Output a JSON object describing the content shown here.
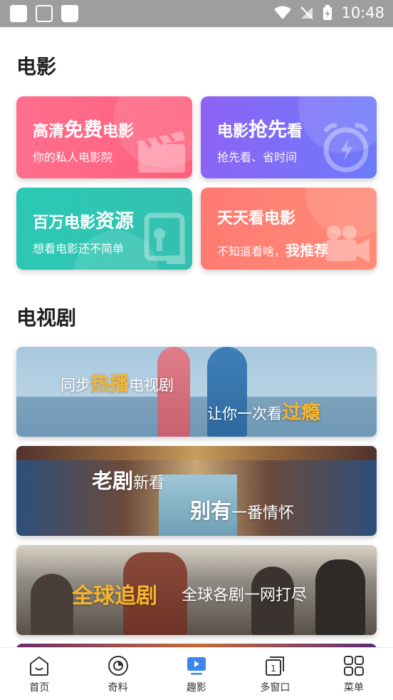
{
  "status_bar": {
    "time": "10:48"
  },
  "movies": {
    "section_title": "电影",
    "cards": [
      {
        "title_pre": "高清",
        "title_big": "免费",
        "title_post": "电影",
        "subtitle": "你的私人电影院",
        "icon": "clapperboard-icon"
      },
      {
        "title_pre": "电影",
        "title_big": "抢先",
        "title_post": "看",
        "subtitle": "抢先看、省时间",
        "icon": "alarm-clock-icon"
      },
      {
        "title_pre": "百万电影",
        "title_big": "资源",
        "title_post": "",
        "subtitle": "想看电影还不简单",
        "icon": "film-doc-icon"
      },
      {
        "title_pre": "天天看电影",
        "title_big": "",
        "title_post": "",
        "subtitle_pre": "不知道看啥，",
        "subtitle_bold": "我推荐",
        "icon": "projector-icon"
      }
    ]
  },
  "tv": {
    "section_title": "电视剧",
    "banners": [
      {
        "line1_pre": "同步",
        "line1_hl": "热播",
        "line1_post": "电视剧",
        "line2_pre": "让你一次看",
        "line2_hl": "过瘾"
      },
      {
        "line1_bold": "老剧",
        "line1_post": "新看",
        "line2_bold": "别有",
        "line2_post": "一番情怀"
      },
      {
        "hl": "全球追剧",
        "rest": "全球各剧一网打尽"
      }
    ]
  },
  "nav": {
    "items": [
      {
        "label": "首页",
        "icon": "home-icon"
      },
      {
        "label": "奇料",
        "icon": "eye-icon"
      },
      {
        "label": "趣影",
        "icon": "video-play-icon",
        "active": true
      },
      {
        "label": "多窗口",
        "icon": "windows-icon",
        "badge": "1"
      },
      {
        "label": "菜单",
        "icon": "grid-menu-icon"
      }
    ]
  },
  "colors": {
    "accent": "#3d86f0",
    "highlight": "#f7b52c"
  }
}
